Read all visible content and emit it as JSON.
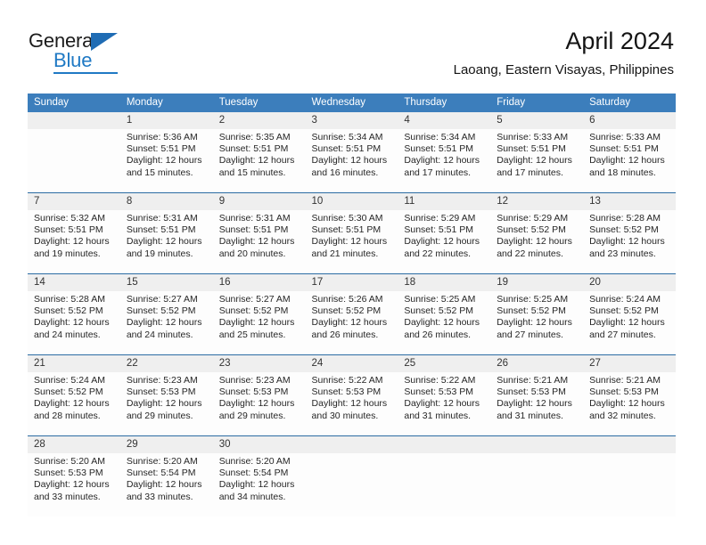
{
  "brand": {
    "name_part1": "General",
    "name_part2": "Blue"
  },
  "header": {
    "title": "April 2024",
    "subtitle": "Laoang, Eastern Visayas, Philippines"
  },
  "weekday_headers": [
    "Sunday",
    "Monday",
    "Tuesday",
    "Wednesday",
    "Thursday",
    "Friday",
    "Saturday"
  ],
  "colors": {
    "header_blue": "#3c7ebc",
    "rule_blue": "#2b6ca3",
    "daynum_band": "#efefef",
    "logo_blue": "#1f79c4"
  },
  "weeks": [
    [
      {
        "day": "",
        "lines": []
      },
      {
        "day": "1",
        "lines": [
          "Sunrise: 5:36 AM",
          "Sunset: 5:51 PM",
          "Daylight: 12 hours",
          "and 15 minutes."
        ]
      },
      {
        "day": "2",
        "lines": [
          "Sunrise: 5:35 AM",
          "Sunset: 5:51 PM",
          "Daylight: 12 hours",
          "and 15 minutes."
        ]
      },
      {
        "day": "3",
        "lines": [
          "Sunrise: 5:34 AM",
          "Sunset: 5:51 PM",
          "Daylight: 12 hours",
          "and 16 minutes."
        ]
      },
      {
        "day": "4",
        "lines": [
          "Sunrise: 5:34 AM",
          "Sunset: 5:51 PM",
          "Daylight: 12 hours",
          "and 17 minutes."
        ]
      },
      {
        "day": "5",
        "lines": [
          "Sunrise: 5:33 AM",
          "Sunset: 5:51 PM",
          "Daylight: 12 hours",
          "and 17 minutes."
        ]
      },
      {
        "day": "6",
        "lines": [
          "Sunrise: 5:33 AM",
          "Sunset: 5:51 PM",
          "Daylight: 12 hours",
          "and 18 minutes."
        ]
      }
    ],
    [
      {
        "day": "7",
        "lines": [
          "Sunrise: 5:32 AM",
          "Sunset: 5:51 PM",
          "Daylight: 12 hours",
          "and 19 minutes."
        ]
      },
      {
        "day": "8",
        "lines": [
          "Sunrise: 5:31 AM",
          "Sunset: 5:51 PM",
          "Daylight: 12 hours",
          "and 19 minutes."
        ]
      },
      {
        "day": "9",
        "lines": [
          "Sunrise: 5:31 AM",
          "Sunset: 5:51 PM",
          "Daylight: 12 hours",
          "and 20 minutes."
        ]
      },
      {
        "day": "10",
        "lines": [
          "Sunrise: 5:30 AM",
          "Sunset: 5:51 PM",
          "Daylight: 12 hours",
          "and 21 minutes."
        ]
      },
      {
        "day": "11",
        "lines": [
          "Sunrise: 5:29 AM",
          "Sunset: 5:51 PM",
          "Daylight: 12 hours",
          "and 22 minutes."
        ]
      },
      {
        "day": "12",
        "lines": [
          "Sunrise: 5:29 AM",
          "Sunset: 5:52 PM",
          "Daylight: 12 hours",
          "and 22 minutes."
        ]
      },
      {
        "day": "13",
        "lines": [
          "Sunrise: 5:28 AM",
          "Sunset: 5:52 PM",
          "Daylight: 12 hours",
          "and 23 minutes."
        ]
      }
    ],
    [
      {
        "day": "14",
        "lines": [
          "Sunrise: 5:28 AM",
          "Sunset: 5:52 PM",
          "Daylight: 12 hours",
          "and 24 minutes."
        ]
      },
      {
        "day": "15",
        "lines": [
          "Sunrise: 5:27 AM",
          "Sunset: 5:52 PM",
          "Daylight: 12 hours",
          "and 24 minutes."
        ]
      },
      {
        "day": "16",
        "lines": [
          "Sunrise: 5:27 AM",
          "Sunset: 5:52 PM",
          "Daylight: 12 hours",
          "and 25 minutes."
        ]
      },
      {
        "day": "17",
        "lines": [
          "Sunrise: 5:26 AM",
          "Sunset: 5:52 PM",
          "Daylight: 12 hours",
          "and 26 minutes."
        ]
      },
      {
        "day": "18",
        "lines": [
          "Sunrise: 5:25 AM",
          "Sunset: 5:52 PM",
          "Daylight: 12 hours",
          "and 26 minutes."
        ]
      },
      {
        "day": "19",
        "lines": [
          "Sunrise: 5:25 AM",
          "Sunset: 5:52 PM",
          "Daylight: 12 hours",
          "and 27 minutes."
        ]
      },
      {
        "day": "20",
        "lines": [
          "Sunrise: 5:24 AM",
          "Sunset: 5:52 PM",
          "Daylight: 12 hours",
          "and 27 minutes."
        ]
      }
    ],
    [
      {
        "day": "21",
        "lines": [
          "Sunrise: 5:24 AM",
          "Sunset: 5:52 PM",
          "Daylight: 12 hours",
          "and 28 minutes."
        ]
      },
      {
        "day": "22",
        "lines": [
          "Sunrise: 5:23 AM",
          "Sunset: 5:53 PM",
          "Daylight: 12 hours",
          "and 29 minutes."
        ]
      },
      {
        "day": "23",
        "lines": [
          "Sunrise: 5:23 AM",
          "Sunset: 5:53 PM",
          "Daylight: 12 hours",
          "and 29 minutes."
        ]
      },
      {
        "day": "24",
        "lines": [
          "Sunrise: 5:22 AM",
          "Sunset: 5:53 PM",
          "Daylight: 12 hours",
          "and 30 minutes."
        ]
      },
      {
        "day": "25",
        "lines": [
          "Sunrise: 5:22 AM",
          "Sunset: 5:53 PM",
          "Daylight: 12 hours",
          "and 31 minutes."
        ]
      },
      {
        "day": "26",
        "lines": [
          "Sunrise: 5:21 AM",
          "Sunset: 5:53 PM",
          "Daylight: 12 hours",
          "and 31 minutes."
        ]
      },
      {
        "day": "27",
        "lines": [
          "Sunrise: 5:21 AM",
          "Sunset: 5:53 PM",
          "Daylight: 12 hours",
          "and 32 minutes."
        ]
      }
    ],
    [
      {
        "day": "28",
        "lines": [
          "Sunrise: 5:20 AM",
          "Sunset: 5:53 PM",
          "Daylight: 12 hours",
          "and 33 minutes."
        ]
      },
      {
        "day": "29",
        "lines": [
          "Sunrise: 5:20 AM",
          "Sunset: 5:54 PM",
          "Daylight: 12 hours",
          "and 33 minutes."
        ]
      },
      {
        "day": "30",
        "lines": [
          "Sunrise: 5:20 AM",
          "Sunset: 5:54 PM",
          "Daylight: 12 hours",
          "and 34 minutes."
        ]
      },
      {
        "day": "",
        "lines": []
      },
      {
        "day": "",
        "lines": []
      },
      {
        "day": "",
        "lines": []
      },
      {
        "day": "",
        "lines": []
      }
    ]
  ]
}
